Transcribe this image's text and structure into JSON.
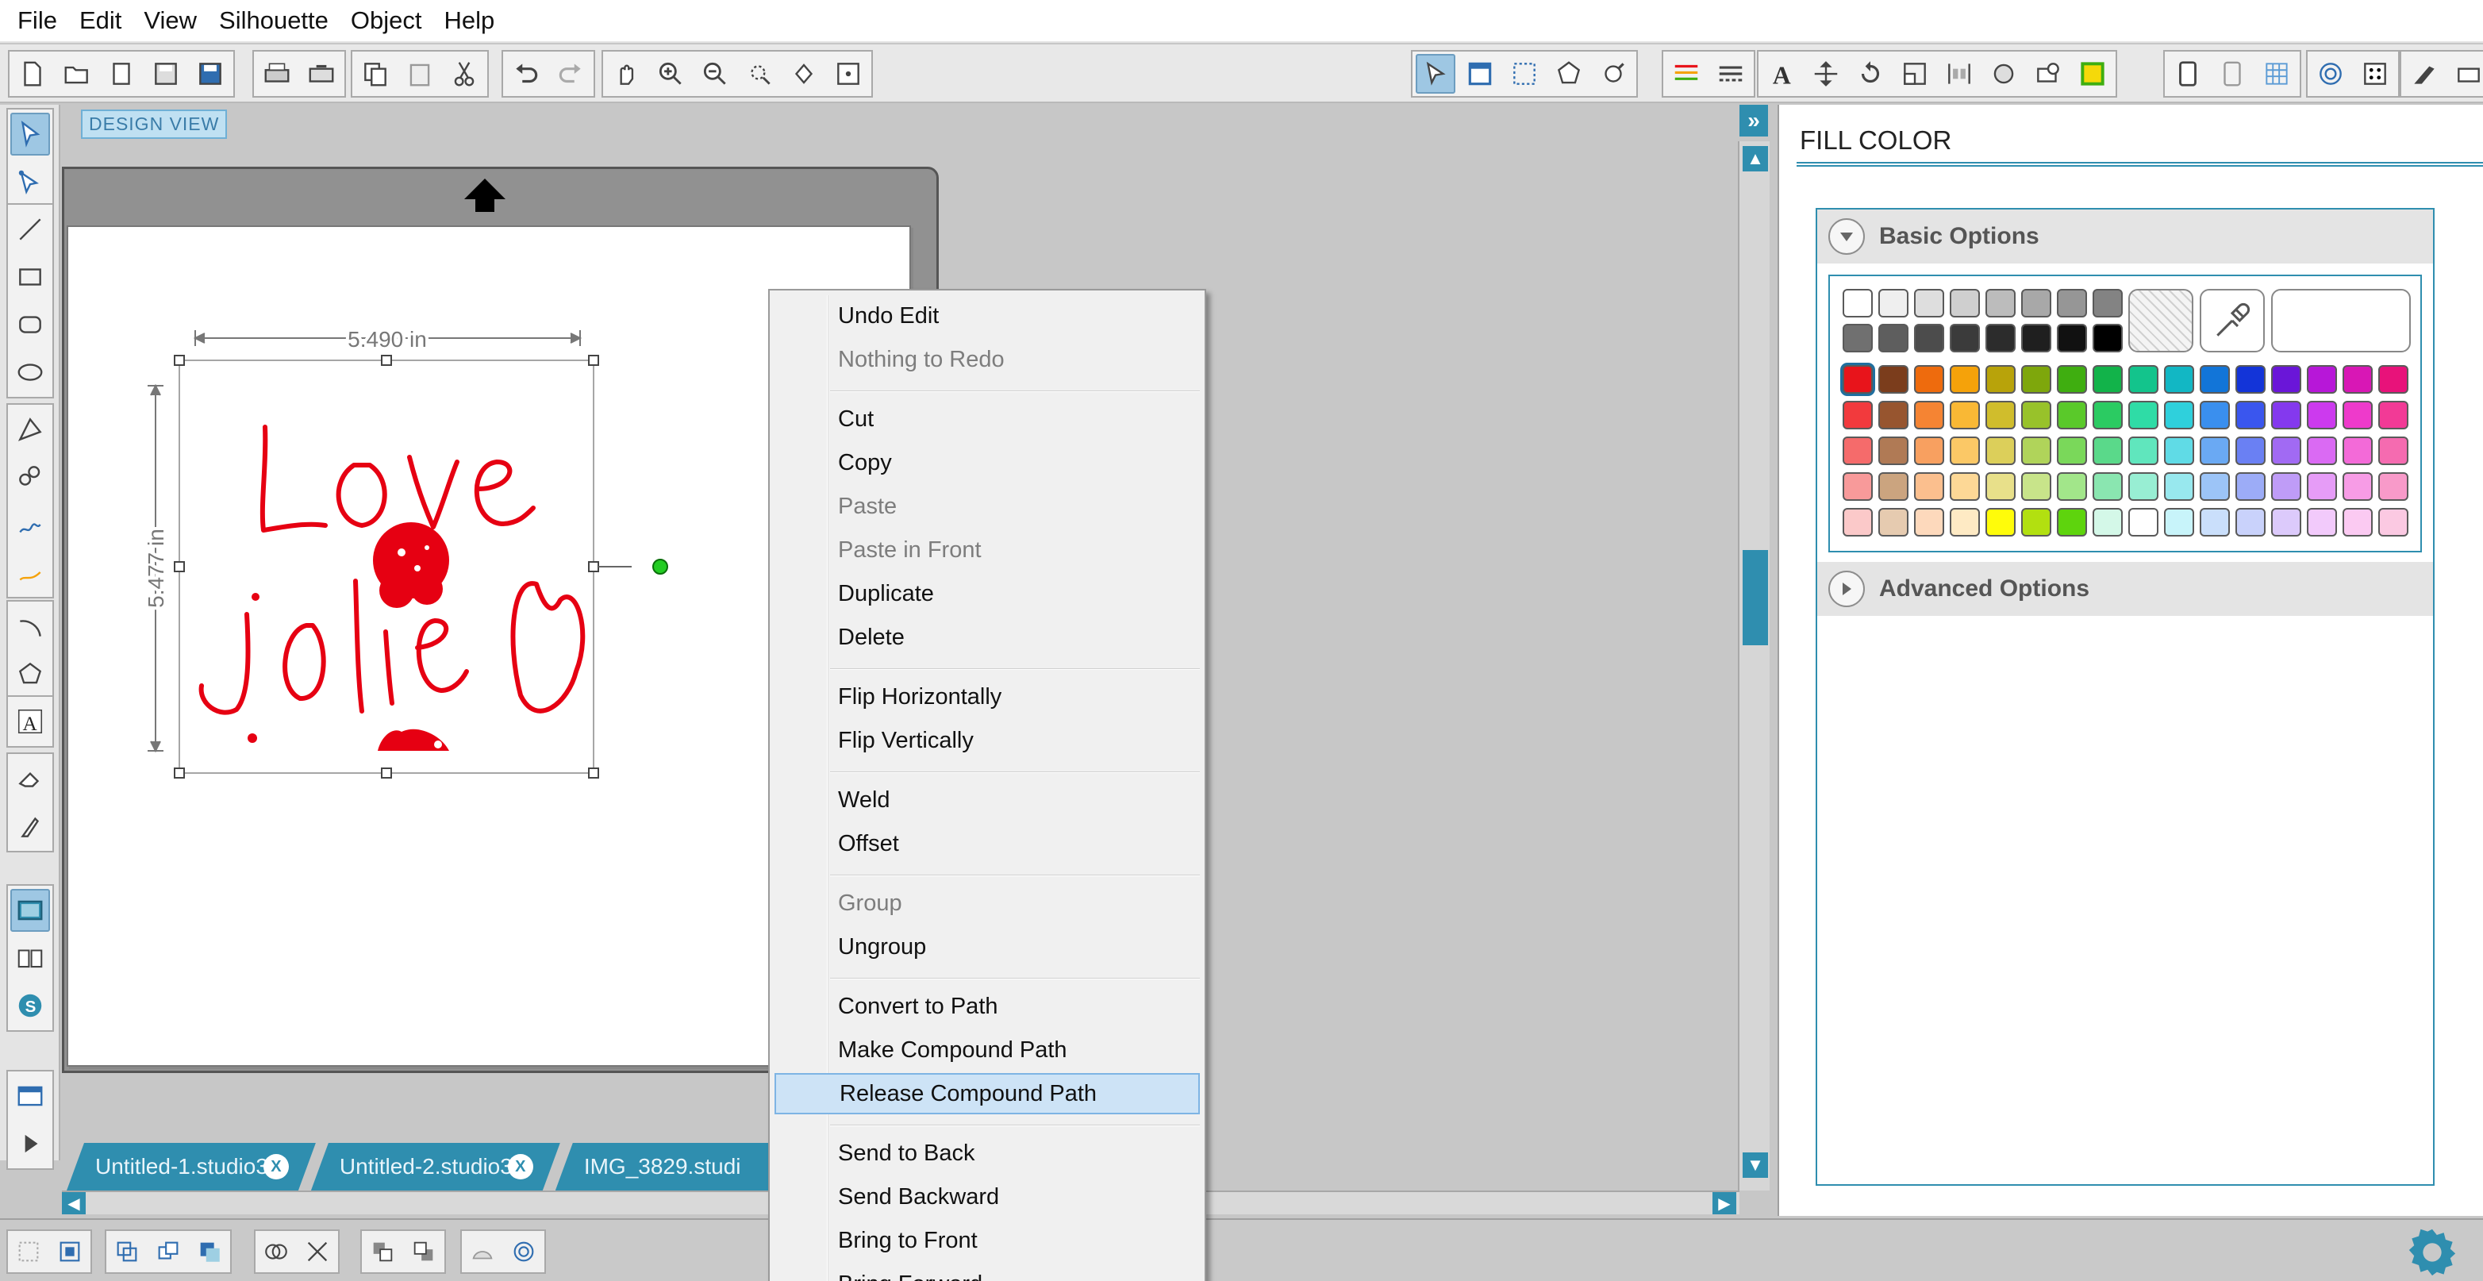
{
  "menubar": {
    "items": [
      "File",
      "Edit",
      "View",
      "Silhouette",
      "Object",
      "Help"
    ]
  },
  "canvas": {
    "view_label": "DESIGN VIEW",
    "width_label": "5.490 in",
    "height_label": "5.477 in",
    "artwork": {
      "word1": "Love",
      "word2": "Jolie",
      "ink_color": "#e60012"
    }
  },
  "doc_tabs": [
    {
      "label": "Untitled-1.studio3",
      "close": "X"
    },
    {
      "label": "Untitled-2.studio3",
      "close": "X"
    },
    {
      "label": "IMG_3829.studi",
      "close": ""
    }
  ],
  "panel": {
    "title": "FILL COLOR",
    "basic_options": "Basic Options",
    "advanced_options": "Advanced Options",
    "gray_row1": [
      "#ffffff",
      "#efefef",
      "#dedede",
      "#cfcfcf",
      "#bcbcbc",
      "#a8a8a8",
      "#969696",
      "#838383"
    ],
    "gray_row2": [
      "#707070",
      "#5e5e5e",
      "#4c4c4c",
      "#3b3b3b",
      "#2c2c2c",
      "#1f1f1f",
      "#111111",
      "#000000"
    ],
    "color_rows": [
      [
        "#e8141b",
        "#7b3d1c",
        "#ee6b0d",
        "#f5a20a",
        "#b8a30a",
        "#7ea70c",
        "#3fae10",
        "#12b34a",
        "#13c48c",
        "#12b7c4",
        "#1275d8",
        "#1334d8",
        "#6a16d8",
        "#b717d8",
        "#d817b5",
        "#e8127a"
      ],
      [
        "#f23a3d",
        "#97552f",
        "#f58433",
        "#f9b835",
        "#d0bd2c",
        "#98c22a",
        "#5ac92a",
        "#2bcb62",
        "#2fdca6",
        "#2fd0dc",
        "#3a8fee",
        "#3a56ee",
        "#8439ee",
        "#cc3aee",
        "#ee3acb",
        "#f23a96"
      ],
      [
        "#f56b6b",
        "#b07a55",
        "#f8a060",
        "#fbc866",
        "#dccf5a",
        "#b0d45a",
        "#7ad85a",
        "#5ad98a",
        "#60e6bd",
        "#60dbe6",
        "#6aa9f3",
        "#6a80f3",
        "#a16af3",
        "#da6af3",
        "#f36ad8",
        "#f56bb0"
      ],
      [
        "#f89a9a",
        "#cba47f",
        "#fbbf8e",
        "#fdd896",
        "#e8e08a",
        "#c8e48a",
        "#a2e68a",
        "#8ae6b0",
        "#98eed3",
        "#98e8ee",
        "#9cc4f7",
        "#9cacf7",
        "#bf9cf7",
        "#e69cf7",
        "#f79ce6",
        "#f89ac9"
      ],
      [
        "#fbc9c9",
        "#e6cbb0",
        "#fdd9bc",
        "#feeac4",
        "#fffc0a",
        "#b2e010",
        "#5ed40d",
        "#d4f8e8",
        "#ffffff",
        "#c8f4fa",
        "#cadffb",
        "#c9d2fb",
        "#dccafb",
        "#f2cafb",
        "#fbcaf2",
        "#fbc9e2"
      ]
    ]
  },
  "context_menu": {
    "items": [
      {
        "label": "Undo Edit",
        "enabled": true
      },
      {
        "label": "Nothing to Redo",
        "enabled": false
      },
      {
        "sep": true
      },
      {
        "label": "Cut",
        "enabled": true
      },
      {
        "label": "Copy",
        "enabled": true
      },
      {
        "label": "Paste",
        "enabled": false
      },
      {
        "label": "Paste in Front",
        "enabled": false
      },
      {
        "label": "Duplicate",
        "enabled": true
      },
      {
        "label": "Delete",
        "enabled": true
      },
      {
        "sep": true
      },
      {
        "label": "Flip Horizontally",
        "enabled": true
      },
      {
        "label": "Flip Vertically",
        "enabled": true
      },
      {
        "sep": true
      },
      {
        "label": "Weld",
        "enabled": true
      },
      {
        "label": "Offset",
        "enabled": true
      },
      {
        "sep": true
      },
      {
        "label": "Group",
        "enabled": false
      },
      {
        "label": "Ungroup",
        "enabled": true
      },
      {
        "sep": true
      },
      {
        "label": "Convert to Path",
        "enabled": true
      },
      {
        "label": "Make Compound Path",
        "enabled": true
      },
      {
        "label": "Release Compound Path",
        "enabled": true,
        "highlighted": true
      },
      {
        "sep": true
      },
      {
        "label": "Send to Back",
        "enabled": true
      },
      {
        "label": "Send Backward",
        "enabled": true
      },
      {
        "label": "Bring to Front",
        "enabled": true
      },
      {
        "label": "Bring Forward",
        "enabled": true
      }
    ]
  },
  "icons": {
    "toolbar": [
      "new-document-icon",
      "open-file-icon",
      "open-library-icon",
      "save-icon",
      "save-as-icon",
      "print-icon",
      "send-to-cutter-icon",
      "copy-icon",
      "paste-icon",
      "cut-icon",
      "undo-icon",
      "redo-icon",
      "pan-hand-icon",
      "zoom-in-icon",
      "zoom-out-icon",
      "zoom-select-icon",
      "zoom-fit-icon",
      "fit-page-icon",
      "select-tool-icon",
      "page-setup-icon",
      "registration-icon",
      "trace-icon",
      "cut-settings-icon",
      "line-color-icon",
      "line-style-icon",
      "text-style-icon",
      "transform-icon",
      "rotate-icon",
      "scale-icon",
      "align-icon",
      "replicate-icon",
      "modify-icon",
      "offset-icon",
      "fill-color-icon",
      "fill-pattern-icon",
      "line-style-panel-icon",
      "grid-icon",
      "trace-panel-icon",
      "dots-icon",
      "knife-icon",
      "eraser-panel-icon"
    ],
    "left": [
      "pointer-tool-icon",
      "edit-points-icon",
      "line-tool-icon",
      "rectangle-tool-icon",
      "rounded-rect-tool-icon",
      "ellipse-tool-icon",
      "polygon-tool-icon",
      "curve-tool-icon",
      "freehand-tool-icon",
      "smooth-freehand-icon",
      "arc-tool-icon",
      "regular-polygon-icon",
      "text-tool-icon",
      "eraser-tool-icon",
      "knife-tool-icon",
      "design-view-icon",
      "library-icon",
      "silhouette-store-icon",
      "show-pane-icon",
      "play-icon"
    ],
    "bottom": [
      "group-icon",
      "ungroup-icon",
      "compound-path-icon",
      "release-compound-icon",
      "make-shadow-icon",
      "weld-icon",
      "delete-all-icon",
      "bring-front-icon",
      "send-back-icon",
      "mirror-icon",
      "offset-small-icon"
    ]
  }
}
